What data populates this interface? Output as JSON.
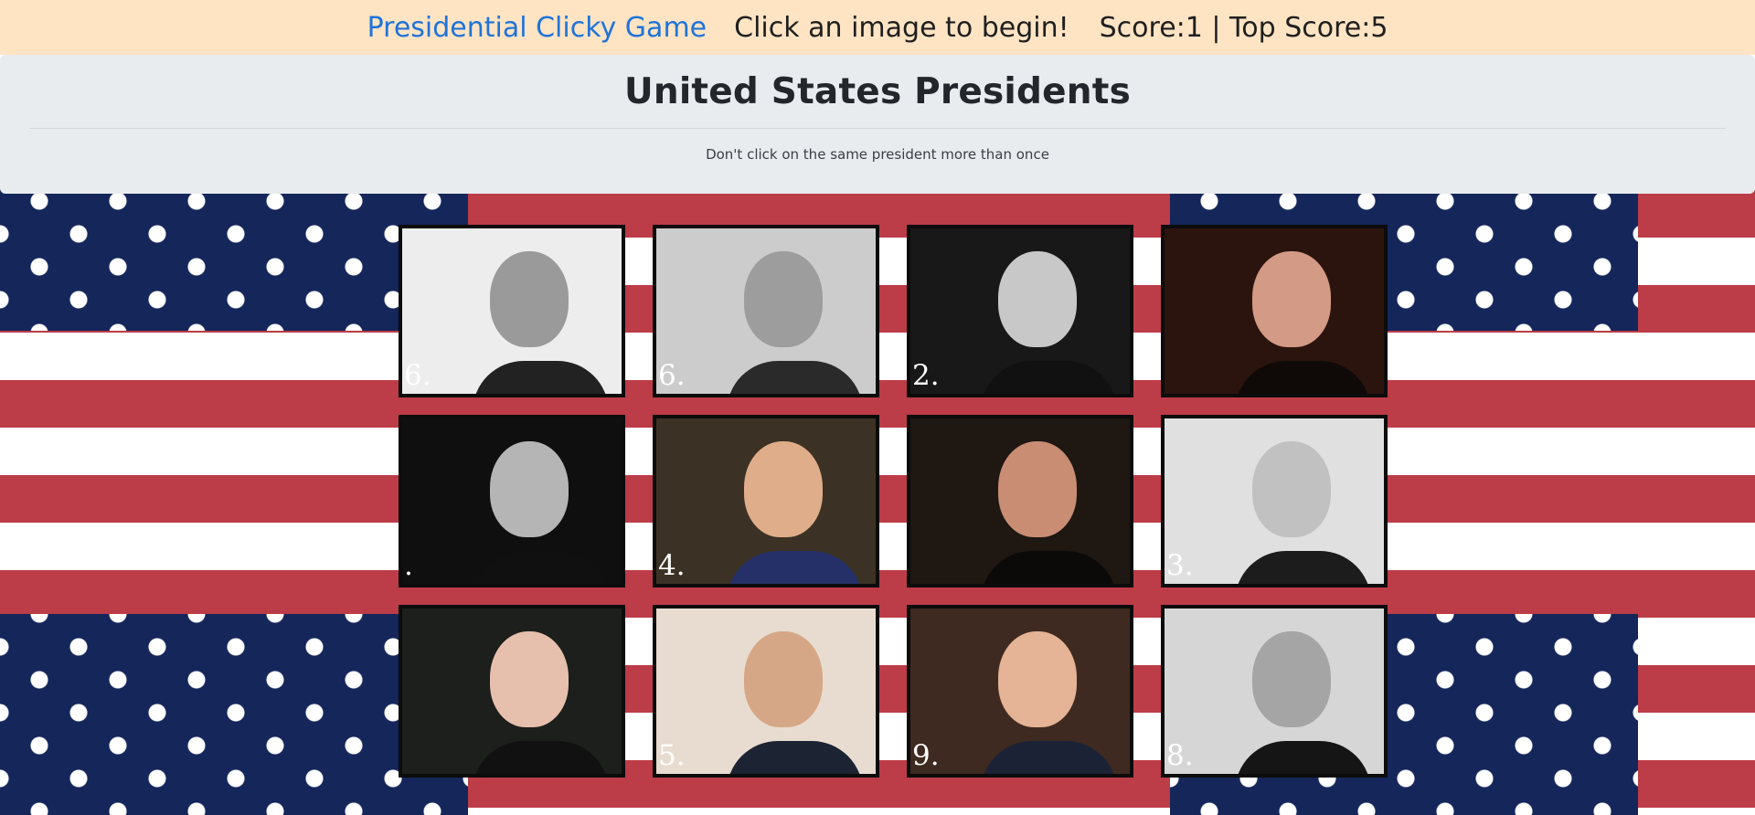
{
  "navbar": {
    "brand": "Presidential Clicky Game",
    "message": "Click an image to begin!",
    "score": "Score:1 | Top Score:5"
  },
  "jumbotron": {
    "title": "United States Presidents",
    "subtitle": "Don't click on the same president more than once"
  },
  "cards": [
    {
      "name": "lincoln-portrait",
      "num_text": "6.",
      "bg": "#ededed",
      "face": "#9a9a9a",
      "suit": "#222222"
    },
    {
      "name": "roosevelt-t-portrait",
      "num_text": "6.",
      "bg": "#cccccc",
      "face": "#9d9d9d",
      "suit": "#2a2a2a"
    },
    {
      "name": "fdr-portrait",
      "num_text": "2.",
      "bg": "#181818",
      "face": "#c8c8c8",
      "suit": "#111111"
    },
    {
      "name": "jackson-portrait",
      "num_text": "",
      "bg": "#2c140e",
      "face": "#d39a86",
      "suit": "#0f0a08"
    },
    {
      "name": "hoover-portrait",
      "num_text": ".",
      "bg": "#0f0f0f",
      "face": "#b5b5b5",
      "suit": "#101010"
    },
    {
      "name": "eisenhower-portrait",
      "num_text": "4.",
      "bg": "#3b3225",
      "face": "#e0ad8a",
      "suit": "#253068"
    },
    {
      "name": "jefferson-portrait",
      "num_text": "",
      "bg": "#1e1712",
      "face": "#c88d73",
      "suit": "#0c0a09"
    },
    {
      "name": "truman-portrait",
      "num_text": "3.",
      "bg": "#e0e0e0",
      "face": "#c1c1c1",
      "suit": "#1c1c1c"
    },
    {
      "name": "washington-portrait",
      "num_text": "",
      "bg": "#1c1f1b",
      "face": "#e7bfad",
      "suit": "#111111"
    },
    {
      "name": "kennedy-portrait",
      "num_text": "5.",
      "bg": "#e8dcd0",
      "face": "#d6a786",
      "suit": "#1c2333"
    },
    {
      "name": "carter-portrait",
      "num_text": "9.",
      "bg": "#3e2a20",
      "face": "#e5b395",
      "suit": "#1b2236"
    },
    {
      "name": "grant-portrait",
      "num_text": "8.",
      "bg": "#d6d6d6",
      "face": "#a5a5a5",
      "suit": "#151515"
    }
  ]
}
